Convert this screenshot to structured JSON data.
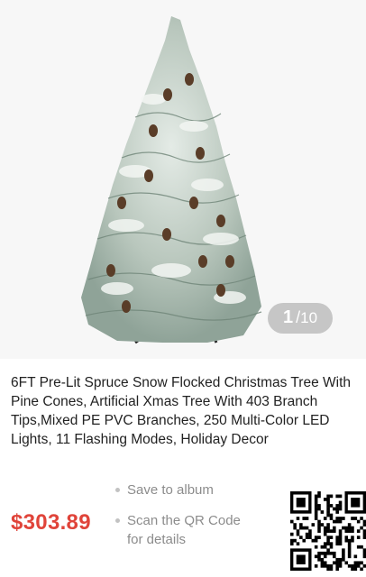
{
  "gallery": {
    "current": "1",
    "separator": "/",
    "total": "10"
  },
  "product": {
    "title": "6FT Pre-Lit Spruce Snow Flocked Christmas Tree With Pine Cones, Artificial Xmas Tree With 403 Branch Tips,Mixed PE PVC Branches, 250 Multi-Color LED Lights, 11 Flashing Modes, Holiday Decor",
    "price": "$303.89"
  },
  "actions": {
    "save": "Save to album",
    "scan_line1": "Scan the QR Code",
    "scan_line2": "for details"
  },
  "colors": {
    "price": "#e0443a",
    "counter_bg": "#c6c6c6"
  }
}
